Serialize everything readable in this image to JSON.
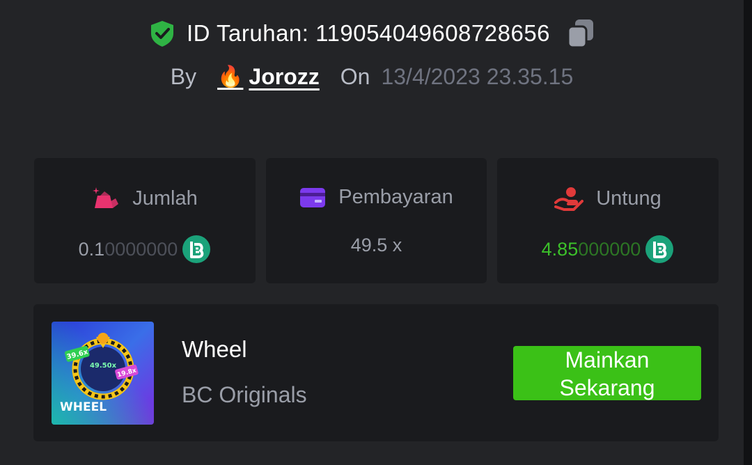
{
  "header": {
    "bet_id_label": "ID Taruhan: 119054049608728656",
    "by_label": "By",
    "username": "Jorozz",
    "user_badge_icon": "flame-icon",
    "on_label": "On",
    "datetime": "13/4/2023 23.35.15"
  },
  "stats": {
    "amount": {
      "label": "Jumlah",
      "value_main": "0.1",
      "value_dim": "0000000",
      "icon": "bet-amount-icon"
    },
    "payout": {
      "label": "Pembayaran",
      "value": "49.5 x",
      "icon": "card-icon"
    },
    "profit": {
      "label": "Untung",
      "value_main": "4.85",
      "value_dim": "000000",
      "icon": "profit-hand-icon"
    }
  },
  "game": {
    "thumb_title": "WHEEL",
    "thumb_multipliers": [
      "39.6x",
      "49.50x",
      "19.8x"
    ],
    "name": "Wheel",
    "provider": "BC Originals",
    "play_label": "Mainkan Sekarang"
  },
  "colors": {
    "background": "#232427",
    "card": "#1a1b1e",
    "accent_green": "#3bc117",
    "profit_green": "#3cc02a",
    "coin_teal": "#1ba27a",
    "shield_green": "#2fb344",
    "amount_icon_pink": "#e8336f",
    "payout_icon_purple": "#7c3aed",
    "profit_icon_red": "#e03a3a"
  }
}
